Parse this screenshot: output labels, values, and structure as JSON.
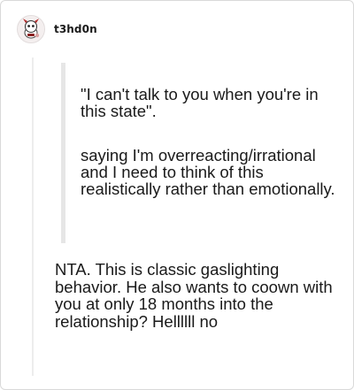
{
  "post": {
    "username": "t3hd0n",
    "quote": {
      "line1": "\"I can't talk to you when you're in this state\".",
      "line2": "saying I'm overreacting/irrational and I need to think of this realistically rather than emotionally."
    },
    "reply": "NTA. This is classic gaslighting behavior. He also wants to coown with you at only 18 months into the relationship? Hellllll no"
  }
}
